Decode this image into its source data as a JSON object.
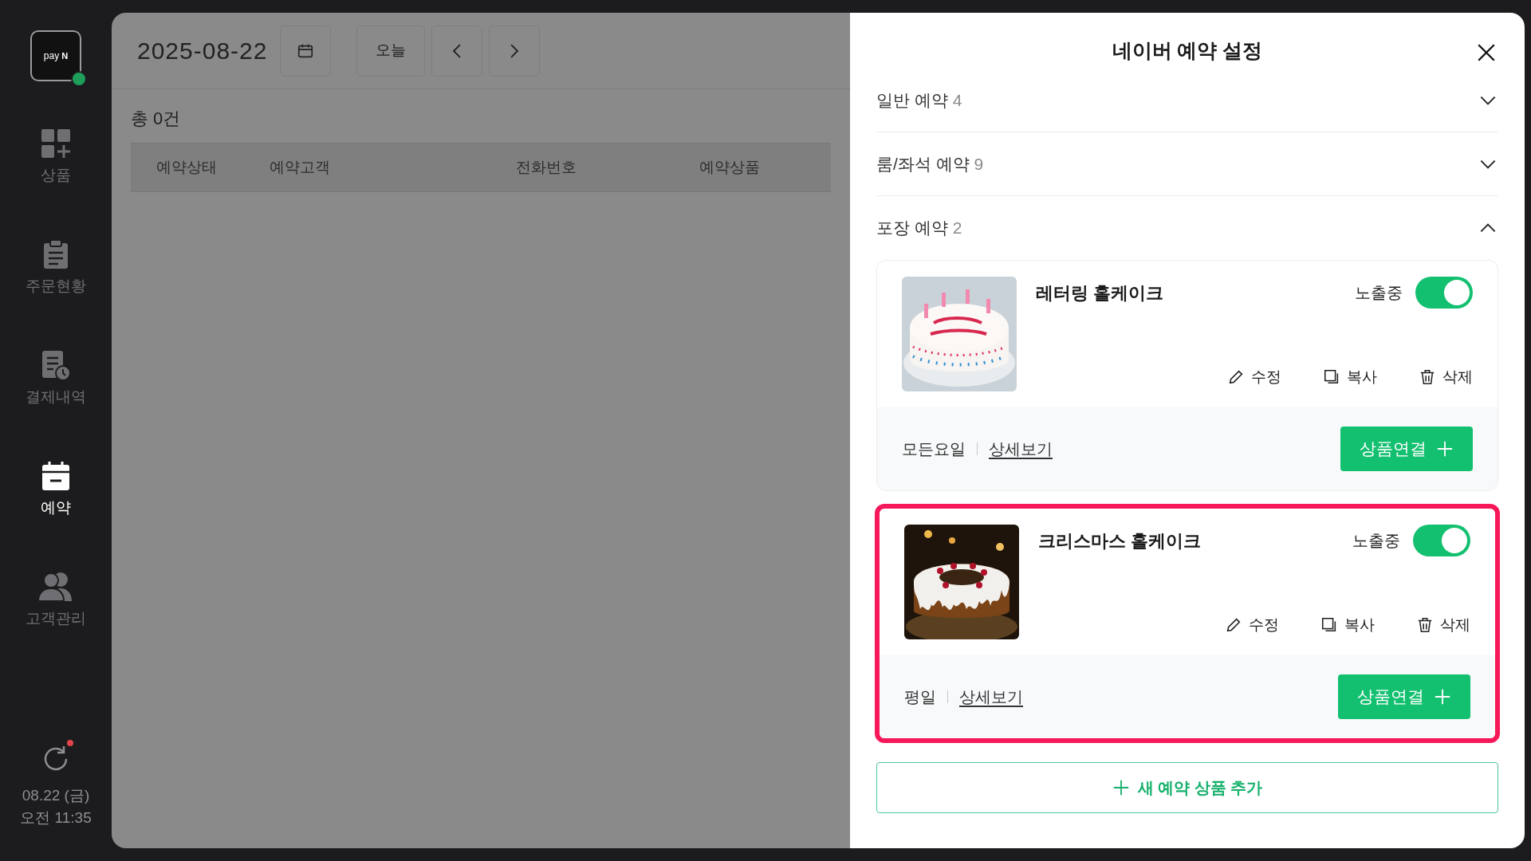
{
  "sidebar": {
    "logo": {
      "text": "pay",
      "mark": "N"
    },
    "items": [
      {
        "label": "상품",
        "selected": false
      },
      {
        "label": "주문현황",
        "selected": false
      },
      {
        "label": "결제내역",
        "selected": false
      },
      {
        "label": "예약",
        "selected": true
      },
      {
        "label": "고객관리",
        "selected": false
      }
    ],
    "sync": {
      "alert": true
    },
    "date": "08.22 (금)",
    "time": "오전 11:35"
  },
  "toolbar": {
    "date": "2025-08-22",
    "today": "오늘"
  },
  "summary": "총 0건",
  "table": {
    "columns": [
      "예약상태",
      "예약고객",
      "전화번호",
      "예약상품"
    ]
  },
  "panel": {
    "title": "네이버 예약 설정",
    "sections": [
      {
        "label": "일반 예약",
        "count": "4",
        "expanded": false
      },
      {
        "label": "룸/좌석 예약",
        "count": "9",
        "expanded": false
      },
      {
        "label": "포장 예약",
        "count": "2",
        "expanded": true,
        "products": [
          {
            "name": "레터링 홀케이크",
            "kind": "picture",
            "status": "노출중",
            "on": true,
            "actions": [
              "수정",
              "복사",
              "삭제"
            ],
            "days": "모든요일",
            "detail": "상세보기",
            "link": "상품연결",
            "highlighted": false
          },
          {
            "name": "크리스마스 홀케이크",
            "kind": "picture",
            "status": "노출중",
            "on": true,
            "actions": [
              "수정",
              "복사",
              "삭제"
            ],
            "days": "평일",
            "detail": "상세보기",
            "link": "상품연결",
            "highlighted": true
          }
        ]
      }
    ],
    "add": "새 예약 상품 추가"
  }
}
